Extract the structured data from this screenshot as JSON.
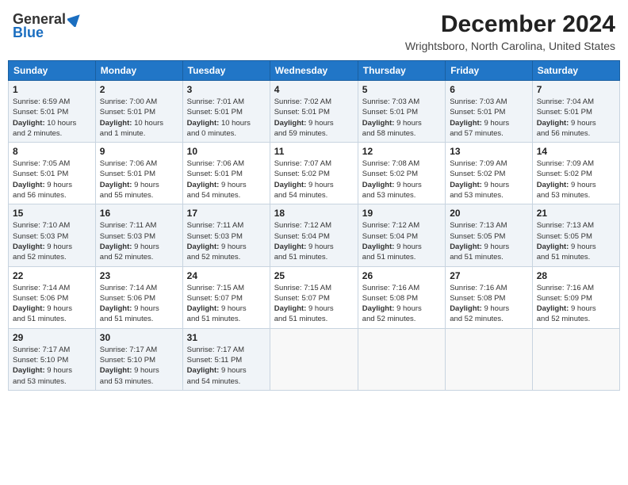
{
  "header": {
    "logo_general": "General",
    "logo_blue": "Blue",
    "month_year": "December 2024",
    "location": "Wrightsboro, North Carolina, United States"
  },
  "weekdays": [
    "Sunday",
    "Monday",
    "Tuesday",
    "Wednesday",
    "Thursday",
    "Friday",
    "Saturday"
  ],
  "weeks": [
    [
      {
        "day": "1",
        "info": "Sunrise: 6:59 AM\nSunset: 5:01 PM\nDaylight: 10 hours\nand 2 minutes."
      },
      {
        "day": "2",
        "info": "Sunrise: 7:00 AM\nSunset: 5:01 PM\nDaylight: 10 hours\nand 1 minute."
      },
      {
        "day": "3",
        "info": "Sunrise: 7:01 AM\nSunset: 5:01 PM\nDaylight: 10 hours\nand 0 minutes."
      },
      {
        "day": "4",
        "info": "Sunrise: 7:02 AM\nSunset: 5:01 PM\nDaylight: 9 hours\nand 59 minutes."
      },
      {
        "day": "5",
        "info": "Sunrise: 7:03 AM\nSunset: 5:01 PM\nDaylight: 9 hours\nand 58 minutes."
      },
      {
        "day": "6",
        "info": "Sunrise: 7:03 AM\nSunset: 5:01 PM\nDaylight: 9 hours\nand 57 minutes."
      },
      {
        "day": "7",
        "info": "Sunrise: 7:04 AM\nSunset: 5:01 PM\nDaylight: 9 hours\nand 56 minutes."
      }
    ],
    [
      {
        "day": "8",
        "info": "Sunrise: 7:05 AM\nSunset: 5:01 PM\nDaylight: 9 hours\nand 56 minutes."
      },
      {
        "day": "9",
        "info": "Sunrise: 7:06 AM\nSunset: 5:01 PM\nDaylight: 9 hours\nand 55 minutes."
      },
      {
        "day": "10",
        "info": "Sunrise: 7:06 AM\nSunset: 5:01 PM\nDaylight: 9 hours\nand 54 minutes."
      },
      {
        "day": "11",
        "info": "Sunrise: 7:07 AM\nSunset: 5:02 PM\nDaylight: 9 hours\nand 54 minutes."
      },
      {
        "day": "12",
        "info": "Sunrise: 7:08 AM\nSunset: 5:02 PM\nDaylight: 9 hours\nand 53 minutes."
      },
      {
        "day": "13",
        "info": "Sunrise: 7:09 AM\nSunset: 5:02 PM\nDaylight: 9 hours\nand 53 minutes."
      },
      {
        "day": "14",
        "info": "Sunrise: 7:09 AM\nSunset: 5:02 PM\nDaylight: 9 hours\nand 53 minutes."
      }
    ],
    [
      {
        "day": "15",
        "info": "Sunrise: 7:10 AM\nSunset: 5:03 PM\nDaylight: 9 hours\nand 52 minutes."
      },
      {
        "day": "16",
        "info": "Sunrise: 7:11 AM\nSunset: 5:03 PM\nDaylight: 9 hours\nand 52 minutes."
      },
      {
        "day": "17",
        "info": "Sunrise: 7:11 AM\nSunset: 5:03 PM\nDaylight: 9 hours\nand 52 minutes."
      },
      {
        "day": "18",
        "info": "Sunrise: 7:12 AM\nSunset: 5:04 PM\nDaylight: 9 hours\nand 51 minutes."
      },
      {
        "day": "19",
        "info": "Sunrise: 7:12 AM\nSunset: 5:04 PM\nDaylight: 9 hours\nand 51 minutes."
      },
      {
        "day": "20",
        "info": "Sunrise: 7:13 AM\nSunset: 5:05 PM\nDaylight: 9 hours\nand 51 minutes."
      },
      {
        "day": "21",
        "info": "Sunrise: 7:13 AM\nSunset: 5:05 PM\nDaylight: 9 hours\nand 51 minutes."
      }
    ],
    [
      {
        "day": "22",
        "info": "Sunrise: 7:14 AM\nSunset: 5:06 PM\nDaylight: 9 hours\nand 51 minutes."
      },
      {
        "day": "23",
        "info": "Sunrise: 7:14 AM\nSunset: 5:06 PM\nDaylight: 9 hours\nand 51 minutes."
      },
      {
        "day": "24",
        "info": "Sunrise: 7:15 AM\nSunset: 5:07 PM\nDaylight: 9 hours\nand 51 minutes."
      },
      {
        "day": "25",
        "info": "Sunrise: 7:15 AM\nSunset: 5:07 PM\nDaylight: 9 hours\nand 51 minutes."
      },
      {
        "day": "26",
        "info": "Sunrise: 7:16 AM\nSunset: 5:08 PM\nDaylight: 9 hours\nand 52 minutes."
      },
      {
        "day": "27",
        "info": "Sunrise: 7:16 AM\nSunset: 5:08 PM\nDaylight: 9 hours\nand 52 minutes."
      },
      {
        "day": "28",
        "info": "Sunrise: 7:16 AM\nSunset: 5:09 PM\nDaylight: 9 hours\nand 52 minutes."
      }
    ],
    [
      {
        "day": "29",
        "info": "Sunrise: 7:17 AM\nSunset: 5:10 PM\nDaylight: 9 hours\nand 53 minutes."
      },
      {
        "day": "30",
        "info": "Sunrise: 7:17 AM\nSunset: 5:10 PM\nDaylight: 9 hours\nand 53 minutes."
      },
      {
        "day": "31",
        "info": "Sunrise: 7:17 AM\nSunset: 5:11 PM\nDaylight: 9 hours\nand 54 minutes."
      },
      {
        "day": "",
        "info": ""
      },
      {
        "day": "",
        "info": ""
      },
      {
        "day": "",
        "info": ""
      },
      {
        "day": "",
        "info": ""
      }
    ]
  ]
}
